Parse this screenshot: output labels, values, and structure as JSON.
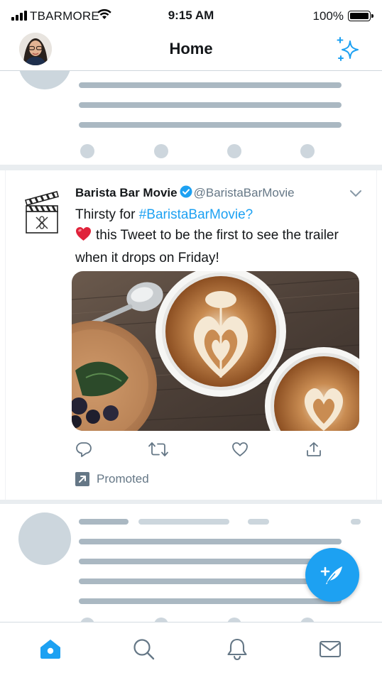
{
  "status_bar": {
    "carrier": "TBARMORE",
    "time": "9:15 AM",
    "battery": "100%"
  },
  "nav": {
    "title": "Home",
    "avatar_icon": "profile-avatar",
    "right_icon": "sparkle-icon"
  },
  "tweet": {
    "display_name": "Barista Bar Movie",
    "handle": "@BaristaBarMovie",
    "text_line1_prefix": "Thirsty for ",
    "hashtag": "#BaristaBarMovie?",
    "heart_emoji": "❤️",
    "text_line2": "this Tweet to be the first to see the trailer when it drops on Friday!",
    "promoted_label": "Promoted",
    "actions": [
      "reply-icon",
      "retweet-icon",
      "like-icon",
      "share-icon"
    ]
  },
  "tab_bar": {
    "tabs": [
      "home-icon",
      "search-icon",
      "notifications-icon",
      "messages-icon"
    ],
    "active": "home-icon"
  },
  "colors": {
    "brand_blue": "#1da1f2",
    "text_primary": "#14171a",
    "text_secondary": "#657786",
    "skeleton": "#aab8c2"
  }
}
